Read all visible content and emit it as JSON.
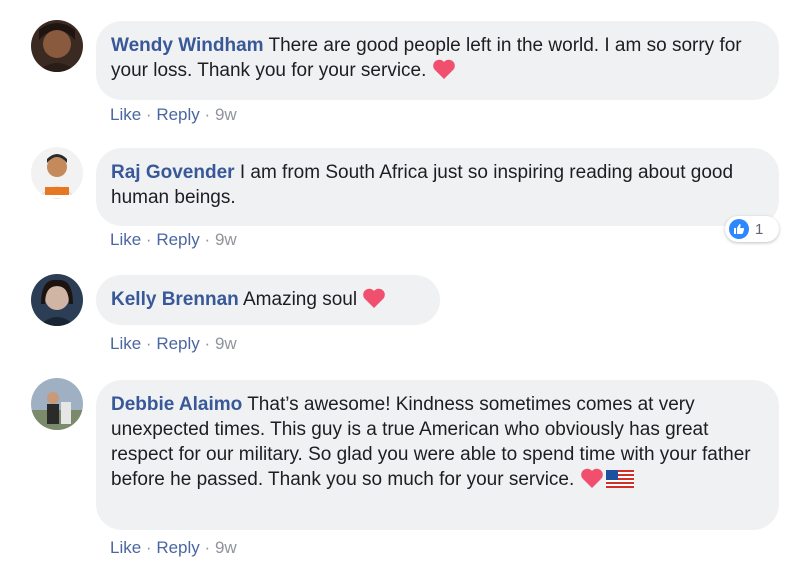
{
  "comments": [
    {
      "author": "Wendy Windham",
      "text": "There are good people left in the world. I am so sorry for your loss. Thank you for your service.",
      "emoji": [
        "heart"
      ],
      "like_label": "Like",
      "reply_label": "Reply",
      "time": "9w"
    },
    {
      "author": "Raj Govender",
      "text": "I am from South Africa just so inspiring reading about good human beings.",
      "emoji": [],
      "like_label": "Like",
      "reply_label": "Reply",
      "time": "9w",
      "reaction_count": "1"
    },
    {
      "author": "Kelly Brennan",
      "text": "Amazing soul",
      "emoji": [
        "heart"
      ],
      "like_label": "Like",
      "reply_label": "Reply",
      "time": "9w"
    },
    {
      "author": "Debbie Alaimo",
      "text": "That’s awesome! Kindness sometimes comes at very unexpected times. This guy is a true American who obviously has great respect for our military. So glad you were able to spend time with your father before he passed. Thank you so much for your service.",
      "emoji": [
        "heart",
        "us-flag"
      ],
      "like_label": "Like",
      "reply_label": "Reply",
      "time": "9w"
    }
  ],
  "colors": {
    "author": "#385898",
    "bubble": "#eff1f3",
    "action_link": "#4b67a1",
    "heart": "#f0506e",
    "like_reaction": "#2d88ff"
  }
}
